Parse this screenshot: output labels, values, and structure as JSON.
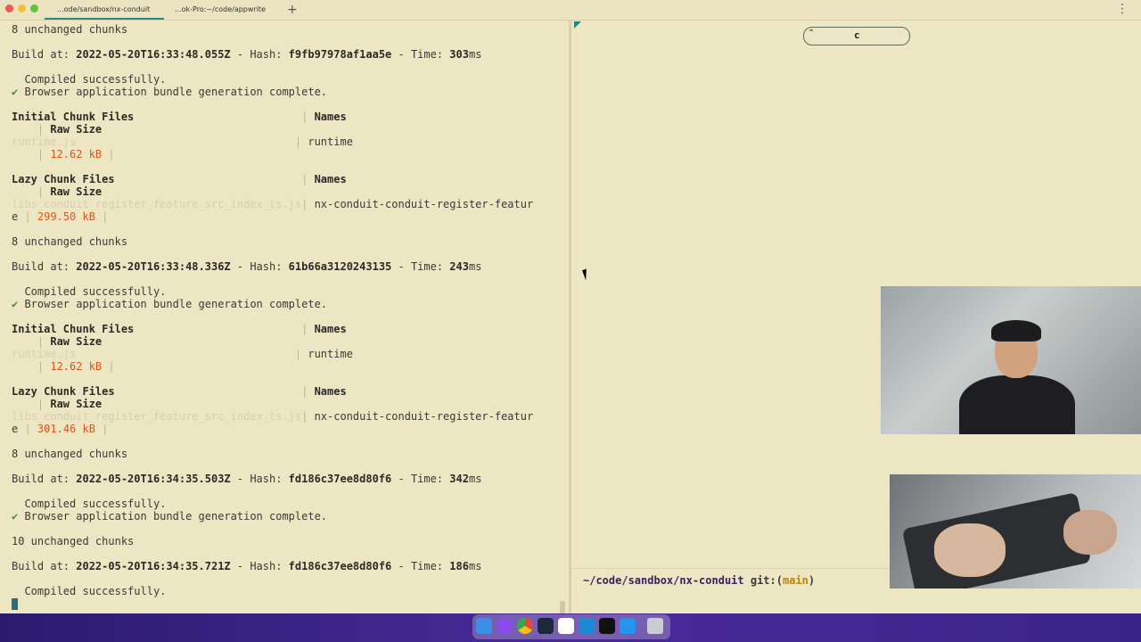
{
  "window": {
    "tabs": [
      {
        "label": "...ode/sandbox/nx-conduit",
        "active": true
      },
      {
        "label": "...ok-Pro:~/code/appwrite",
        "active": false
      }
    ],
    "add_tab_label": "+",
    "menu_label": "⋮"
  },
  "terminal_left": {
    "lines": [
      {
        "segments": [
          {
            "t": "8 unchanged chunks",
            "c": ""
          }
        ]
      },
      {
        "segments": [
          {
            "t": "Build at: ",
            "c": ""
          },
          {
            "t": "2022-05-20T16:33:48.055Z",
            "c": "b"
          },
          {
            "t": " - Hash: ",
            "c": ""
          },
          {
            "t": "f9fb97978af1aa5e",
            "c": "b"
          },
          {
            "t": " - Time: ",
            "c": ""
          },
          {
            "t": "303",
            "c": "b"
          },
          {
            "t": "ms",
            "c": ""
          }
        ]
      },
      {
        "segments": [
          {
            "t": "  Compiled successfully.",
            "c": ""
          }
        ]
      },
      {
        "segments": [
          {
            "t": "✔",
            "c": "g"
          },
          {
            "t": " Browser application bundle generation complete.",
            "c": ""
          }
        ]
      },
      {
        "segments": [
          {
            "t": "Initial Chunk Files",
            "c": "b"
          },
          {
            "t": "                          | ",
            "c": "sep"
          },
          {
            "t": "Names",
            "c": "b"
          }
        ]
      },
      {
        "segments": [
          {
            "t": "    | ",
            "c": "sep"
          },
          {
            "t": "Raw Size",
            "c": "b"
          }
        ]
      },
      {
        "segments": [
          {
            "t": "runtime.js",
            "c": "faint"
          },
          {
            "t": "                                  | ",
            "c": "sep"
          },
          {
            "t": "runtime",
            "c": ""
          }
        ]
      },
      {
        "segments": [
          {
            "t": "    | ",
            "c": "sep"
          },
          {
            "t": "12.62 kB",
            "c": "o"
          },
          {
            "t": " |",
            "c": "sep"
          }
        ]
      },
      {
        "segments": [
          {
            "t": "Lazy Chunk Files",
            "c": "b"
          },
          {
            "t": "                             | ",
            "c": "sep"
          },
          {
            "t": "Names",
            "c": "b"
          }
        ]
      },
      {
        "segments": [
          {
            "t": "    | ",
            "c": "sep"
          },
          {
            "t": "Raw Size",
            "c": "b"
          }
        ]
      },
      {
        "segments": [
          {
            "t": "libs_conduit_register_feature_src_index_ts.js",
            "c": "faint"
          },
          {
            "t": "| ",
            "c": "sep"
          },
          {
            "t": "nx-conduit-conduit-register-featur",
            "c": ""
          }
        ]
      },
      {
        "segments": [
          {
            "t": "e",
            "c": ""
          },
          {
            "t": " | ",
            "c": "sep"
          },
          {
            "t": "299.50 kB",
            "c": "o"
          },
          {
            "t": " |",
            "c": "sep"
          }
        ]
      },
      {
        "segments": [
          {
            "t": "8 unchanged chunks",
            "c": ""
          }
        ]
      },
      {
        "segments": [
          {
            "t": "Build at: ",
            "c": ""
          },
          {
            "t": "2022-05-20T16:33:48.336Z",
            "c": "b"
          },
          {
            "t": " - Hash: ",
            "c": ""
          },
          {
            "t": "61b66a3120243135",
            "c": "b"
          },
          {
            "t": " - Time: ",
            "c": ""
          },
          {
            "t": "243",
            "c": "b"
          },
          {
            "t": "ms",
            "c": ""
          }
        ]
      },
      {
        "segments": [
          {
            "t": "  Compiled successfully.",
            "c": ""
          }
        ]
      },
      {
        "segments": [
          {
            "t": "✔",
            "c": "g"
          },
          {
            "t": " Browser application bundle generation complete.",
            "c": ""
          }
        ]
      },
      {
        "segments": [
          {
            "t": "Initial Chunk Files",
            "c": "b"
          },
          {
            "t": "                          | ",
            "c": "sep"
          },
          {
            "t": "Names",
            "c": "b"
          }
        ]
      },
      {
        "segments": [
          {
            "t": "    | ",
            "c": "sep"
          },
          {
            "t": "Raw Size",
            "c": "b"
          }
        ]
      },
      {
        "segments": [
          {
            "t": "runtime.js",
            "c": "faint"
          },
          {
            "t": "                                  | ",
            "c": "sep"
          },
          {
            "t": "runtime",
            "c": ""
          }
        ]
      },
      {
        "segments": [
          {
            "t": "    | ",
            "c": "sep"
          },
          {
            "t": "12.62 kB",
            "c": "o"
          },
          {
            "t": " |",
            "c": "sep"
          }
        ]
      },
      {
        "segments": [
          {
            "t": "Lazy Chunk Files",
            "c": "b"
          },
          {
            "t": "                             | ",
            "c": "sep"
          },
          {
            "t": "Names",
            "c": "b"
          }
        ]
      },
      {
        "segments": [
          {
            "t": "    | ",
            "c": "sep"
          },
          {
            "t": "Raw Size",
            "c": "b"
          }
        ]
      },
      {
        "segments": [
          {
            "t": "libs_conduit_register_feature_src_index_ts.js",
            "c": "faint"
          },
          {
            "t": "| ",
            "c": "sep"
          },
          {
            "t": "nx-conduit-conduit-register-featur",
            "c": ""
          }
        ]
      },
      {
        "segments": [
          {
            "t": "e",
            "c": ""
          },
          {
            "t": " | ",
            "c": "sep"
          },
          {
            "t": "301.46 kB",
            "c": "o"
          },
          {
            "t": " |",
            "c": "sep"
          }
        ]
      },
      {
        "segments": [
          {
            "t": "8 unchanged chunks",
            "c": ""
          }
        ]
      },
      {
        "segments": [
          {
            "t": "Build at: ",
            "c": ""
          },
          {
            "t": "2022-05-20T16:34:35.503Z",
            "c": "b"
          },
          {
            "t": " - Hash: ",
            "c": ""
          },
          {
            "t": "fd186c37ee8d80f6",
            "c": "b"
          },
          {
            "t": " - Time: ",
            "c": ""
          },
          {
            "t": "342",
            "c": "b"
          },
          {
            "t": "ms",
            "c": ""
          }
        ]
      },
      {
        "segments": [
          {
            "t": "  Compiled successfully.",
            "c": ""
          }
        ]
      },
      {
        "segments": [
          {
            "t": "✔",
            "c": "g"
          },
          {
            "t": " Browser application bundle generation complete.",
            "c": ""
          }
        ]
      },
      {
        "segments": [
          {
            "t": "10 unchanged chunks",
            "c": ""
          }
        ]
      },
      {
        "segments": [
          {
            "t": "Build at: ",
            "c": ""
          },
          {
            "t": "2022-05-20T16:34:35.721Z",
            "c": "b"
          },
          {
            "t": " - Hash: ",
            "c": ""
          },
          {
            "t": "fd186c37ee8d80f6",
            "c": "b"
          },
          {
            "t": " - Time: ",
            "c": ""
          },
          {
            "t": "186",
            "c": "b"
          },
          {
            "t": "ms",
            "c": ""
          }
        ]
      },
      {
        "segments": [
          {
            "t": "  Compiled successfully.",
            "c": ""
          }
        ]
      }
    ]
  },
  "terminal_right": {
    "search_value": "c",
    "search_toggle_icon": "chevrons-up-icon",
    "prompt": {
      "path": "~/code/sandbox/nx-conduit",
      "git_label": "git:(",
      "branch": "main",
      "git_close": ")"
    }
  },
  "dock": {
    "icons": [
      "finder-icon",
      "messenger-icon",
      "chrome-icon",
      "terminal-icon",
      "slack-icon",
      "vscode-icon",
      "webstorm-icon",
      "docker-icon",
      "trash-icon"
    ]
  },
  "colors": {
    "background": "#ede6c3",
    "accent": "#2a8a8a",
    "size_orange": "#d9551d"
  }
}
